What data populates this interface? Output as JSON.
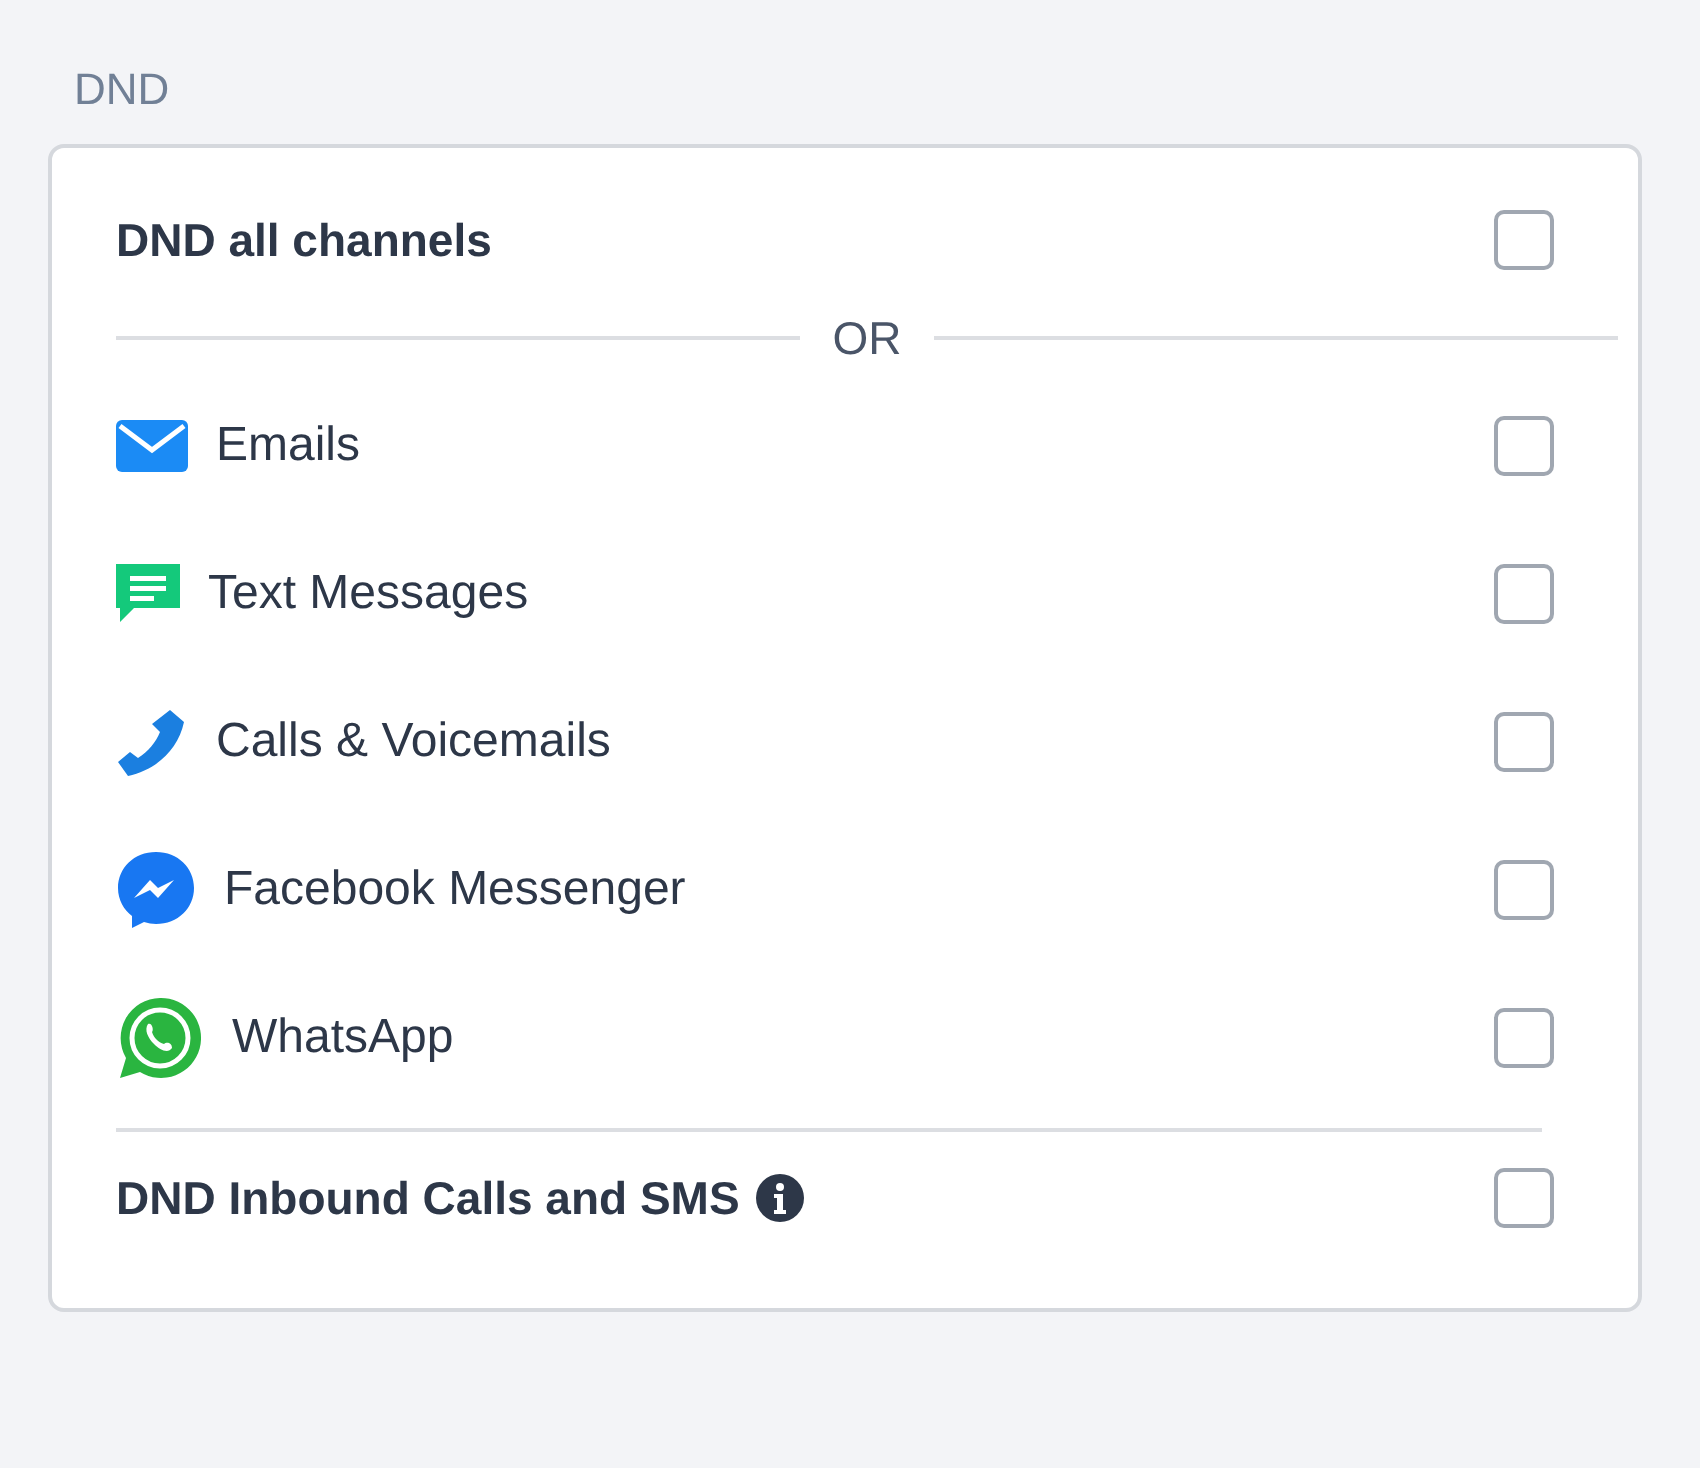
{
  "section_title": "DND",
  "all_channels": {
    "label": "DND all channels",
    "checked": false
  },
  "separator": "OR",
  "channels": [
    {
      "kind": "email",
      "label": "Emails",
      "checked": false
    },
    {
      "kind": "sms",
      "label": "Text Messages",
      "checked": false
    },
    {
      "kind": "call",
      "label": "Calls & Voicemails",
      "checked": false
    },
    {
      "kind": "messenger",
      "label": "Facebook Messenger",
      "checked": false
    },
    {
      "kind": "whatsapp",
      "label": "WhatsApp",
      "checked": false
    }
  ],
  "inbound": {
    "label": "DND Inbound Calls and SMS",
    "checked": false
  }
}
